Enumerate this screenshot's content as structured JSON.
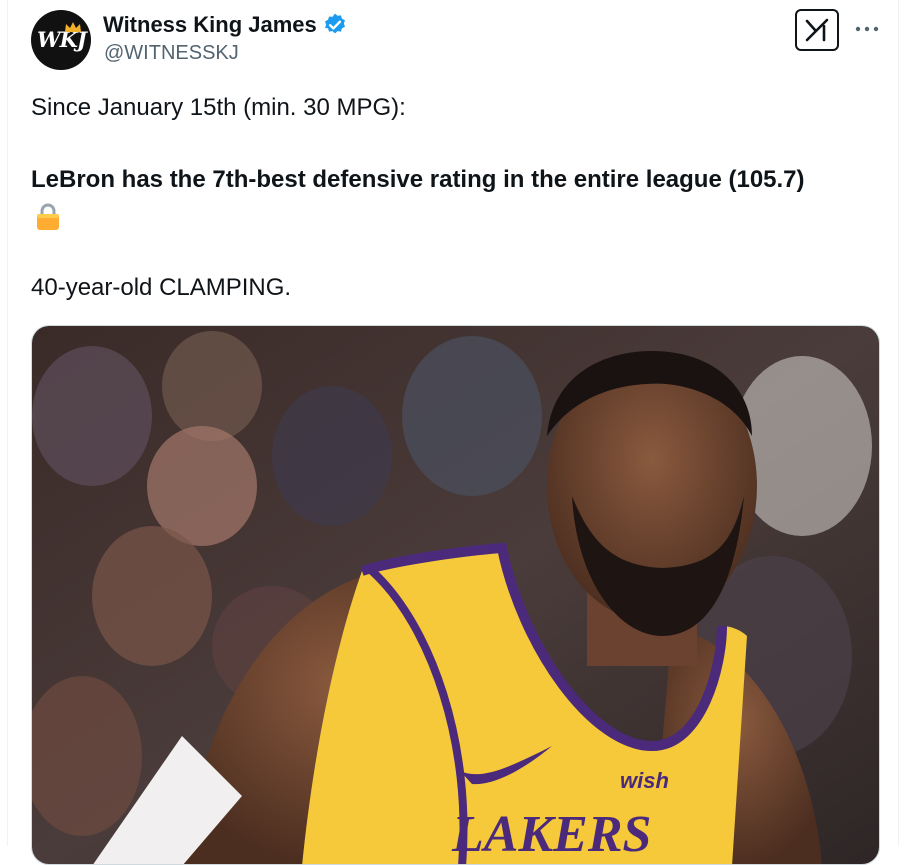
{
  "author": {
    "display_name": "Witness King James",
    "handle": "@WITNESSKJ",
    "avatar_initials": "WKJ",
    "verified": true
  },
  "tweet": {
    "line1": "Since January 15th (min. 30 MPG):",
    "line2": "LeBron has the 7th-best defensive rating in the entire league (105.7)",
    "lock_emoji": "🔒",
    "line3": "40-year-old CLAMPING."
  },
  "media": {
    "jersey_sponsor": "wish",
    "jersey_text": "LAKERS"
  },
  "icons": {
    "verified": "verified-badge-icon",
    "grok": "grok-icon",
    "more": "more-options-icon",
    "lock": "lock-icon"
  },
  "colors": {
    "verified_blue": "#1d9bf0",
    "text_primary": "#0f1419",
    "text_secondary": "#536471",
    "lakers_gold": "#f5c93a",
    "lakers_purple": "#4b2a7b"
  }
}
